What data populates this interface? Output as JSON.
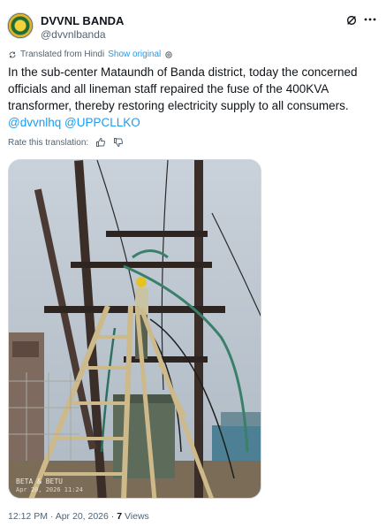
{
  "account": {
    "display_name": "DVVNL BANDA",
    "handle": "@dvvnlbanda"
  },
  "translation": {
    "label": "Translated from Hindi",
    "show_original": "Show original",
    "rate_label": "Rate this translation:"
  },
  "tweet": {
    "text": "In the sub-center Mataundh of Banda district, today the concerned officials and all lineman staff repaired the fuse of the 400KVA transformer, thereby restoring electricity supply to all consumers.",
    "mentions": [
      "@dvvnlhq",
      "@UPPCLLKO"
    ]
  },
  "media": {
    "watermark": "BETA & BETU",
    "watermark_date": "Apr 20, 2026 11:24"
  },
  "meta": {
    "time": "12:12 PM",
    "separator": "·",
    "date": "Apr 20, 2026",
    "views_count": "7",
    "views_label": "Views"
  },
  "colors": {
    "accent": "#1d9bf0",
    "text": "#0f1419",
    "muted": "#536471"
  }
}
